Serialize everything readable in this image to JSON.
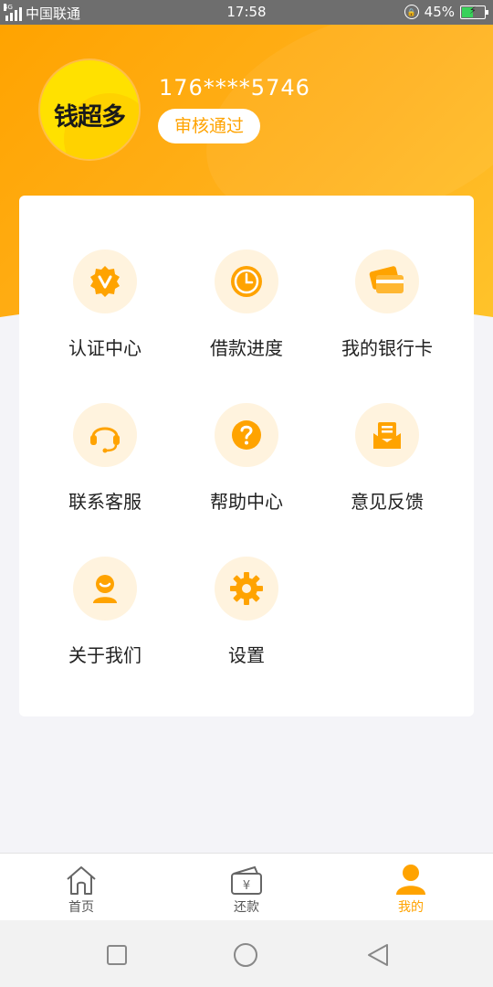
{
  "status_bar": {
    "network": "4G",
    "carrier": "中国联通",
    "time": "17:58",
    "battery": "45%"
  },
  "profile": {
    "avatar_logo": "钱超多",
    "phone": "176****5746",
    "status": "审核通过"
  },
  "menu": {
    "items": [
      {
        "label": "认证中心",
        "icon": "verified-badge-icon"
      },
      {
        "label": "借款进度",
        "icon": "clock-icon"
      },
      {
        "label": "我的银行卡",
        "icon": "bank-card-icon"
      },
      {
        "label": "联系客服",
        "icon": "headset-icon"
      },
      {
        "label": "帮助中心",
        "icon": "help-icon"
      },
      {
        "label": "意见反馈",
        "icon": "feedback-icon"
      },
      {
        "label": "关于我们",
        "icon": "about-us-icon"
      },
      {
        "label": "设置",
        "icon": "gear-icon"
      }
    ]
  },
  "bottom_nav": {
    "items": [
      {
        "label": "首页",
        "icon": "home-icon"
      },
      {
        "label": "还款",
        "icon": "repay-wallet-icon"
      },
      {
        "label": "我的",
        "icon": "user-icon"
      }
    ],
    "active_index": 2
  },
  "colors": {
    "accent": "#ffa300",
    "icon_bg": "#fff3de",
    "header_gradient_start": "#ffa300",
    "header_gradient_end": "#ffc32a"
  }
}
